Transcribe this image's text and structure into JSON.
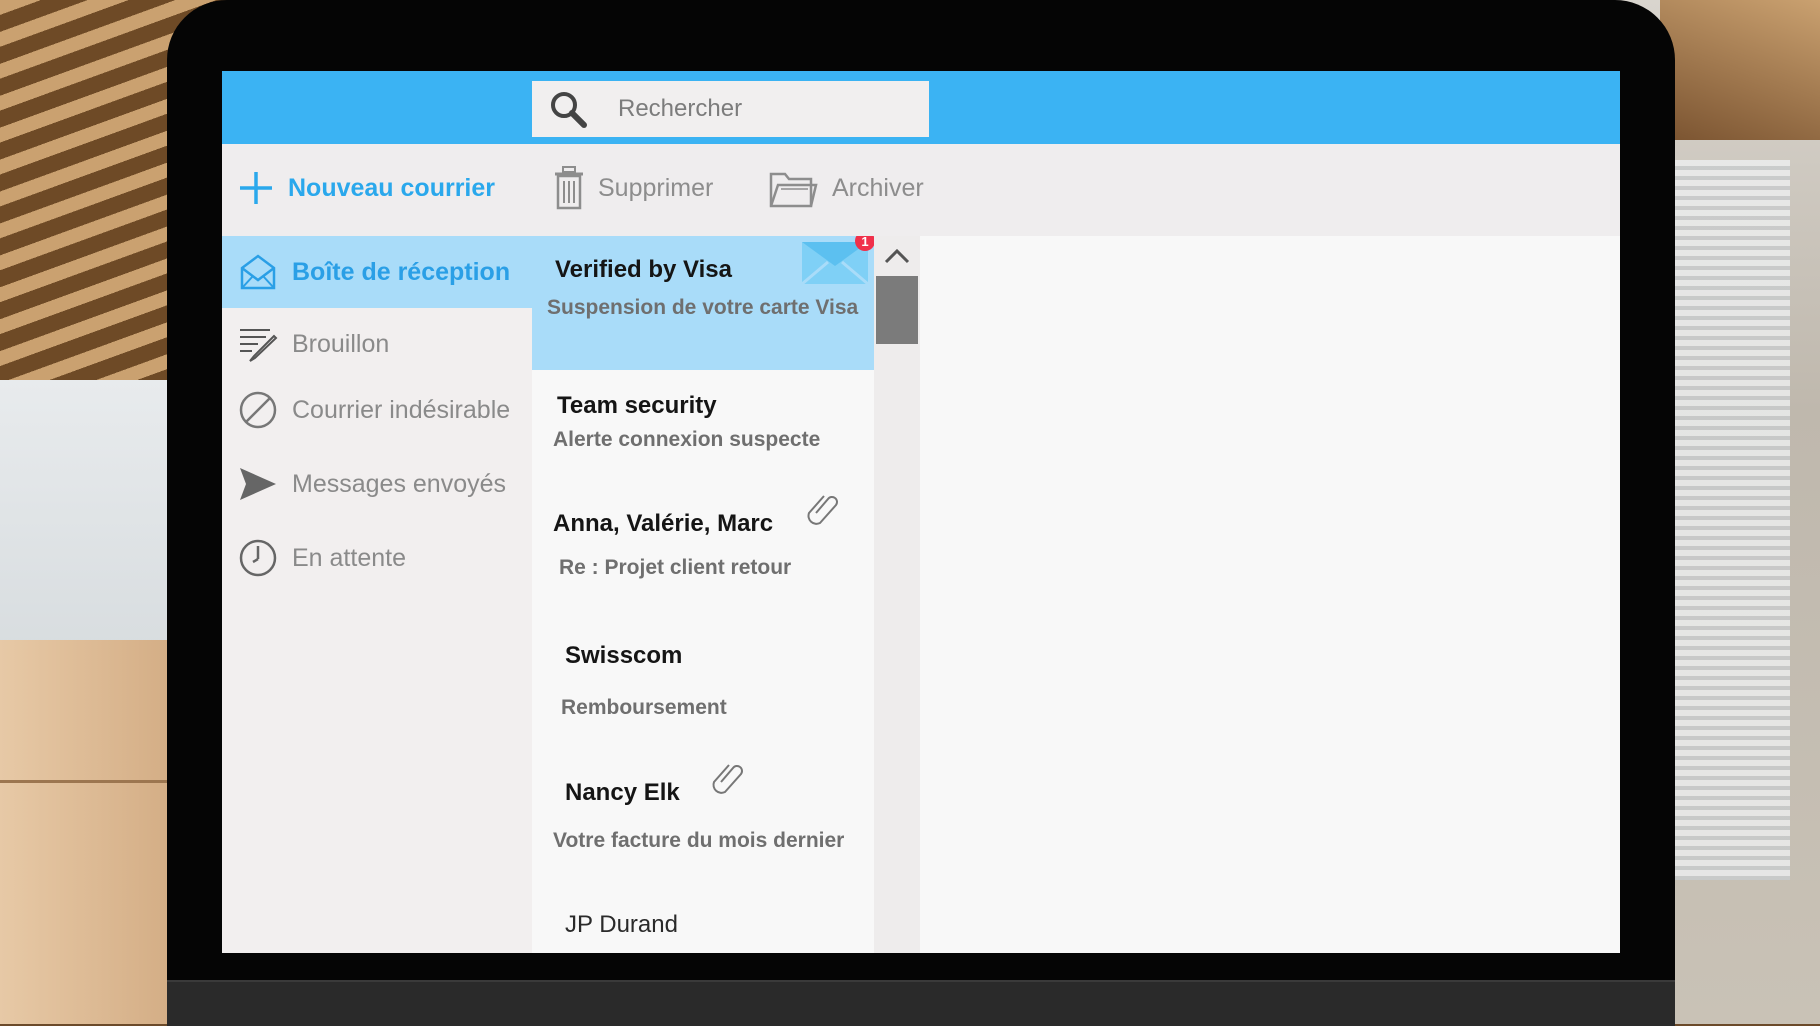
{
  "search": {
    "placeholder": "Rechercher",
    "icon": "search-icon"
  },
  "toolbar": {
    "new_mail": "Nouveau courrier",
    "delete": "Supprimer",
    "archive": "Archiver"
  },
  "sidebar": {
    "items": [
      {
        "label": "Boîte de réception",
        "icon": "inbox-icon",
        "active": true
      },
      {
        "label": "Brouillon",
        "icon": "draft-icon"
      },
      {
        "label": "Courrier indésirable",
        "icon": "spam-icon"
      },
      {
        "label": "Messages envoyés",
        "icon": "send-icon"
      },
      {
        "label": "En attente",
        "icon": "clock-icon"
      }
    ]
  },
  "messages": [
    {
      "sender": "Verified by Visa",
      "subject": "Suspension de votre carte Visa",
      "unread_count": "1",
      "selected": true
    },
    {
      "sender": "Team security",
      "subject": "Alerte connexion suspecte"
    },
    {
      "sender": "Anna, Valérie, Marc",
      "subject": "Re : Projet client retour",
      "attachment": true
    },
    {
      "sender": "Swisscom",
      "subject": "Remboursement"
    },
    {
      "sender": "Nancy Elk",
      "subject": "Votre facture du mois dernier",
      "attachment": true
    },
    {
      "sender": "JP Durand",
      "subject": ""
    }
  ],
  "colors": {
    "accent": "#3bb3f3",
    "selected": "#a9dcf9",
    "badge": "#f0304a"
  }
}
